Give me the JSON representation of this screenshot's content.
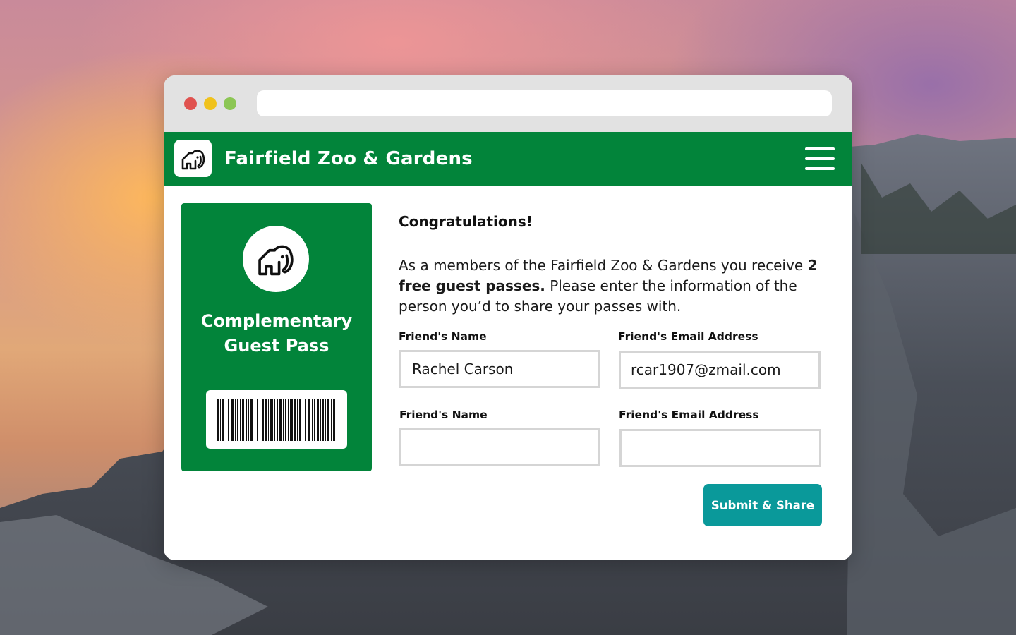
{
  "browser": {
    "url_value": ""
  },
  "header": {
    "site_title": "Fairfield Zoo & Gardens",
    "logo_icon": "elephant-icon",
    "menu_icon": "hamburger-menu-icon",
    "brand_color": "#02843a"
  },
  "pass_card": {
    "icon": "elephant-icon",
    "title_line1": "Complementary",
    "title_line2": "Guest Pass",
    "barcode_icon": "barcode-icon"
  },
  "main": {
    "heading": "Congratulations!",
    "message_part1": "As a members of the Fairfield Zoo & Gardens you receive ",
    "message_bold": "2 free guest passes.",
    "message_part2": " Please enter the information of the person you’d to share your passes with."
  },
  "form": {
    "friend1": {
      "name_label": "Friend's Name",
      "name_value": "Rachel Carson",
      "email_label": "Friend's Email Address",
      "email_value": "rcar1907@zmail.com"
    },
    "friend2": {
      "name_label": "Friend's Name",
      "name_value": "",
      "email_label": "Friend's Email Address",
      "email_value": ""
    },
    "submit_label": "Submit & Share",
    "submit_color": "#0a999a"
  }
}
